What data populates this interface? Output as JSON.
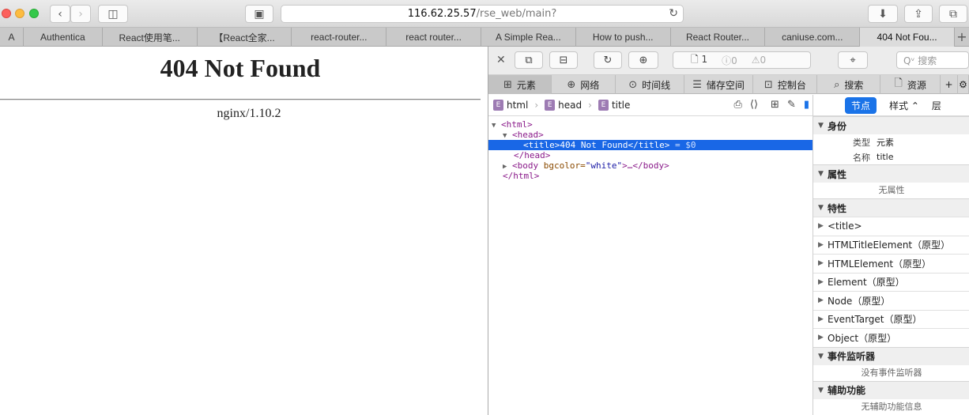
{
  "browser": {
    "url_host": "116.62.25.57",
    "url_path": "/rse_web/main?",
    "tabs": [
      {
        "label": "A",
        "width": 30
      },
      {
        "label": "Authentica",
        "width": 60
      },
      {
        "label": "React使用笔...",
        "width": 120
      },
      {
        "label": "【React全家...",
        "width": 120
      },
      {
        "label": "react-router...",
        "width": 120
      },
      {
        "label": "react router...",
        "width": 120
      },
      {
        "label": "A Simple Rea...",
        "width": 120
      },
      {
        "label": "How to push...",
        "width": 120
      },
      {
        "label": "React Router...",
        "width": 120
      },
      {
        "label": "caniuse.com...",
        "width": 120
      },
      {
        "label": "404 Not Fou...",
        "width": 120,
        "active": true
      }
    ],
    "add_tab": "+"
  },
  "page": {
    "title": "404 Not Found",
    "server": "nginx/1.10.2"
  },
  "inspector": {
    "counts": {
      "nodes": "1",
      "errors": "0",
      "warnings": "0"
    },
    "search_placeholder": "Qᵛ 搜索",
    "tabs": [
      "元素",
      "网络",
      "时间线",
      "储存空间",
      "控制台",
      "搜索",
      "资源"
    ],
    "breadcrumb": [
      "html",
      "head",
      "title"
    ],
    "tree": {
      "html_open": "<html>",
      "head_open": "<head>",
      "title_line": "<title>404 Not Found</title>",
      "selected_suffix": " = $0",
      "head_close": "</head>",
      "body_tag": "<body",
      "body_attr": " bgcolor=",
      "body_val": "\"white\"",
      "body_rest": ">…</body>",
      "html_close": "</html>"
    },
    "side_tabs": {
      "node": "节点",
      "style": "样式 ⌃",
      "layer": "层"
    },
    "sections": {
      "identity": "身份",
      "type_key": "类型",
      "type_val": "元素",
      "name_key": "名称",
      "name_val": "title",
      "attributes": "属性",
      "no_attributes": "无属性",
      "properties": "特性",
      "protos": [
        "<title>",
        "HTMLTitleElement（原型）",
        "HTMLElement（原型）",
        "Element（原型）",
        "Node（原型）",
        "EventTarget（原型）",
        "Object（原型）"
      ],
      "event_listeners": "事件监听器",
      "no_listeners": "没有事件监听器",
      "accessibility": "辅助功能",
      "no_accessibility": "无辅助功能信息"
    }
  }
}
